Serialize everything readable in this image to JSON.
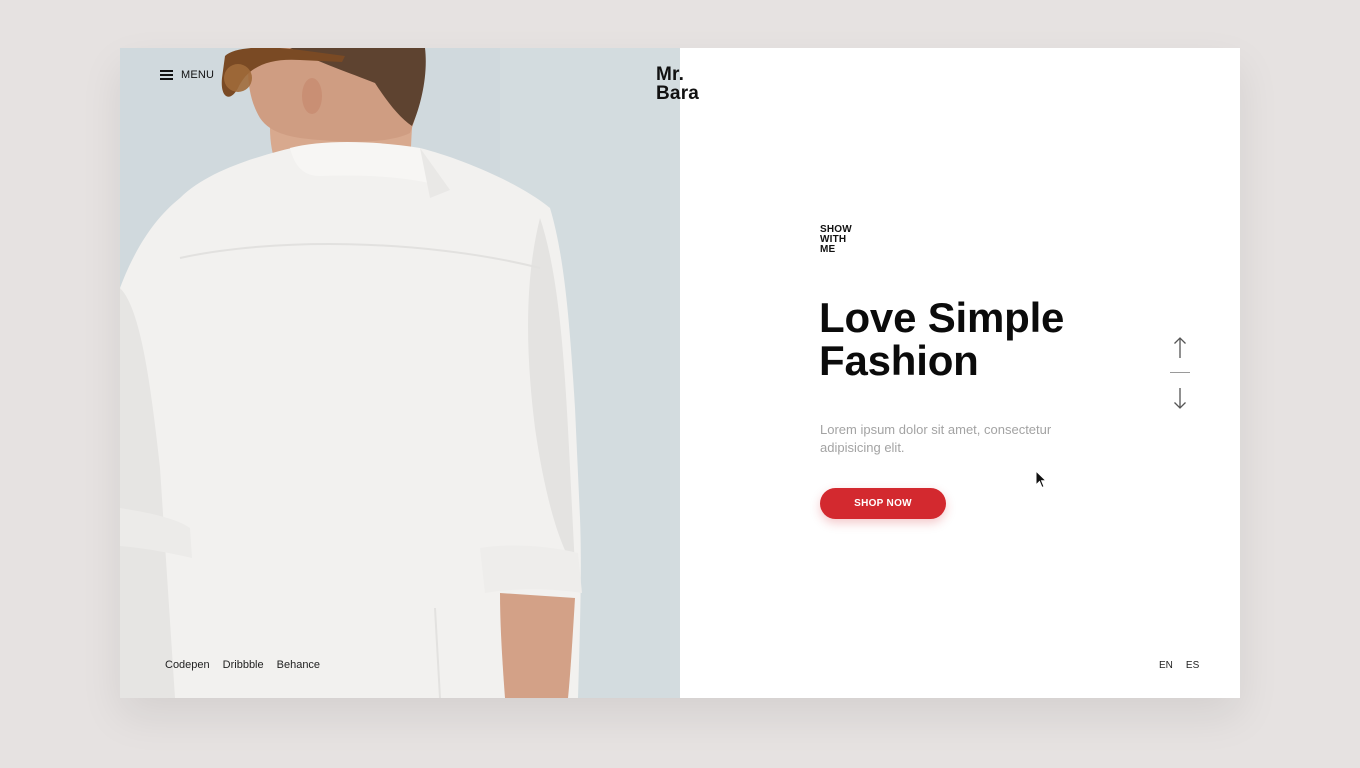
{
  "header": {
    "menu_label": "MENU",
    "logo_line1": "Mr.",
    "logo_line2": "Bara"
  },
  "hero": {
    "eyebrow_line1": "SHOW",
    "eyebrow_line2": "WITH",
    "eyebrow_line3": "ME",
    "title_line1": "Love Simple",
    "title_line2": "Fashion",
    "description": "Lorem ipsum dolor sit amet, consectetur adipisicing elit.",
    "cta_label": "SHOP NOW"
  },
  "socials": [
    {
      "label": "Codepen"
    },
    {
      "label": "Dribbble"
    },
    {
      "label": "Behance"
    }
  ],
  "languages": [
    {
      "label": "EN"
    },
    {
      "label": "ES"
    }
  ],
  "icons": {
    "menu": "hamburger-icon",
    "prev": "arrow-up-icon",
    "next": "arrow-down-icon"
  },
  "colors": {
    "page_background": "#e6e2e1",
    "photo_background": "#cfd8dc",
    "accent": "#d3292f",
    "text_primary": "#0b0b0b",
    "text_muted": "#a3a3a3"
  }
}
